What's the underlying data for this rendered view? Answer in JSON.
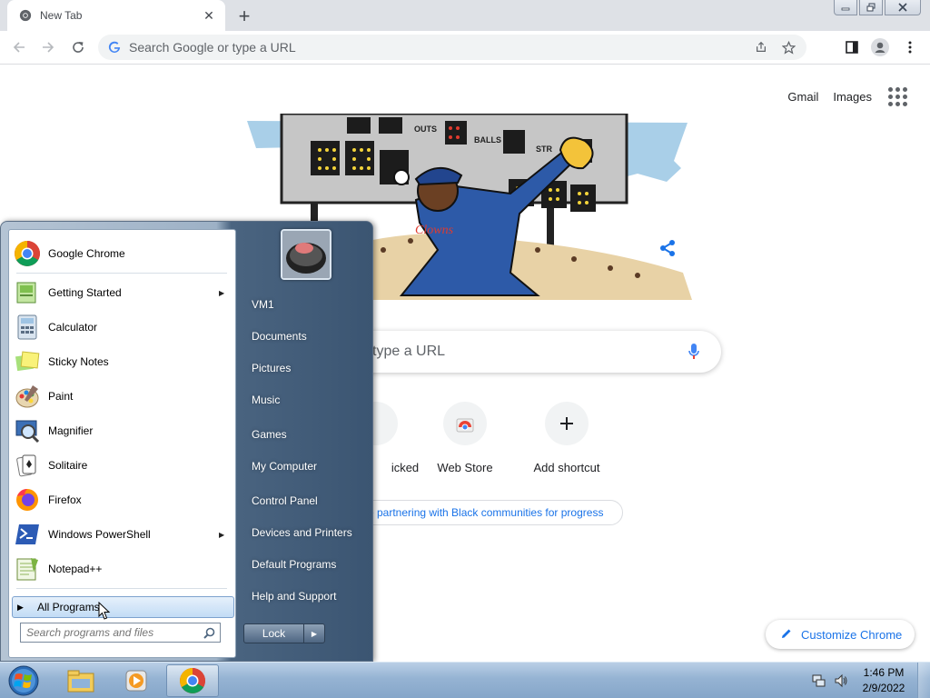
{
  "browser": {
    "tab_title": "New Tab",
    "omnibox_placeholder": "Search Google or type a URL"
  },
  "ntp": {
    "links": [
      "Gmail",
      "Images"
    ],
    "search_placeholder": "Search Google or type a URL",
    "search_visible_text": "type a URL",
    "doodle_board_labels": [
      "OUTS",
      "BALLS",
      "STR"
    ],
    "doodle_jersey_text": "Clowns",
    "shortcuts": [
      {
        "label": "Most visited",
        "visible_label": "icked"
      },
      {
        "label": "Web Store",
        "visible_label": "Web Store"
      },
      {
        "label": "Add shortcut",
        "visible_label": "Add shortcut"
      }
    ],
    "promo_text": "re partnering with Black communities for progress",
    "customize_label": "Customize Chrome"
  },
  "start_menu": {
    "pinned": [
      {
        "label": "Google Chrome",
        "icon": "chrome-icon",
        "submenu": false
      }
    ],
    "recent": [
      {
        "label": "Getting Started",
        "icon": "getting-started-icon",
        "submenu": true
      },
      {
        "label": "Calculator",
        "icon": "calculator-icon",
        "submenu": false
      },
      {
        "label": "Sticky Notes",
        "icon": "sticky-notes-icon",
        "submenu": false
      },
      {
        "label": "Paint",
        "icon": "paint-icon",
        "submenu": false
      },
      {
        "label": "Magnifier",
        "icon": "magnifier-icon",
        "submenu": false
      },
      {
        "label": "Solitaire",
        "icon": "solitaire-icon",
        "submenu": false
      },
      {
        "label": "Firefox",
        "icon": "firefox-icon",
        "submenu": false
      },
      {
        "label": "Windows PowerShell",
        "icon": "powershell-icon",
        "submenu": true
      },
      {
        "label": "Notepad++",
        "icon": "notepadpp-icon",
        "submenu": false
      }
    ],
    "all_programs": "All Programs",
    "search_placeholder": "Search programs and files",
    "right_items": [
      "VM1",
      "Documents",
      "Pictures",
      "Music",
      "Games",
      "My Computer",
      "Control Panel",
      "Devices and Printers",
      "Default Programs",
      "Help and Support"
    ],
    "lock_label": "Lock"
  },
  "taskbar": {
    "time": "1:46 PM",
    "date": "2/9/2022",
    "pinned": [
      "explorer-icon",
      "media-player-icon",
      "chrome-icon"
    ],
    "active": "chrome-icon"
  },
  "colors": {
    "link_blue": "#1a73e8",
    "tab_strip": "#dee1e6",
    "taskbar": "#95b3d3"
  }
}
